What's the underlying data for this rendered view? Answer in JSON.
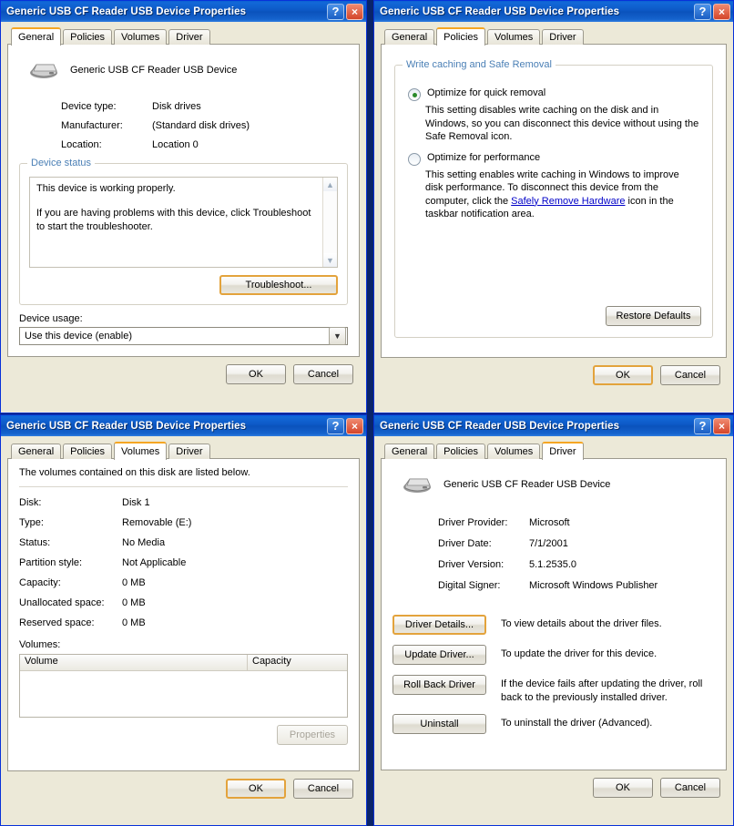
{
  "window": {
    "title": "Generic USB CF Reader USB Device Properties",
    "help_label": "?",
    "close_label": "×",
    "ok_label": "OK",
    "cancel_label": "Cancel"
  },
  "tabs": [
    {
      "label": "General"
    },
    {
      "label": "Policies"
    },
    {
      "label": "Volumes"
    },
    {
      "label": "Driver"
    }
  ],
  "general": {
    "device_name": "Generic USB CF Reader USB Device",
    "properties": [
      {
        "label": "Device type:",
        "value": "Disk drives"
      },
      {
        "label": "Manufacturer:",
        "value": "(Standard disk drives)"
      },
      {
        "label": "Location:",
        "value": "Location 0"
      }
    ],
    "status_group_label": "Device status",
    "status_line1": "This device is working properly.",
    "status_line2": "If you are having problems with this device, click Troubleshoot to start the troubleshooter.",
    "troubleshoot_label": "Troubleshoot...",
    "usage_label": "Device usage:",
    "usage_value": "Use this device (enable)"
  },
  "policies": {
    "group_label": "Write caching and Safe Removal",
    "option1_label": "Optimize for quick removal",
    "option1_desc": "This setting disables write caching on the disk and in Windows, so you can disconnect this device without using the Safe Removal icon.",
    "option1_selected": true,
    "option2_label": "Optimize for performance",
    "option2_desc_pre": "This setting enables write caching in Windows to improve disk performance. To disconnect this device from the computer, click the ",
    "option2_link": "Safely Remove Hardware",
    "option2_desc_post": " icon in the taskbar notification area.",
    "option2_selected": false,
    "restore_defaults_label": "Restore Defaults"
  },
  "volumes": {
    "intro": "The volumes contained on this disk are listed below.",
    "properties": [
      {
        "label": "Disk:",
        "value": "Disk 1"
      },
      {
        "label": "Type:",
        "value": "Removable (E:)"
      },
      {
        "label": "Status:",
        "value": "No Media"
      },
      {
        "label": "Partition style:",
        "value": "Not Applicable"
      },
      {
        "label": "Capacity:",
        "value": "0 MB"
      },
      {
        "label": "Unallocated space:",
        "value": "0 MB"
      },
      {
        "label": "Reserved space:",
        "value": "0 MB"
      }
    ],
    "volumes_label": "Volumes:",
    "columns": [
      "Volume",
      "Capacity"
    ],
    "rows": [],
    "properties_button_label": "Properties"
  },
  "driver": {
    "device_name": "Generic USB CF Reader USB Device",
    "properties": [
      {
        "label": "Driver Provider:",
        "value": "Microsoft"
      },
      {
        "label": "Driver Date:",
        "value": "7/1/2001"
      },
      {
        "label": "Driver Version:",
        "value": "5.1.2535.0"
      },
      {
        "label": "Digital Signer:",
        "value": "Microsoft Windows Publisher"
      }
    ],
    "actions": [
      {
        "button": "Driver Details...",
        "desc": "To view details about the driver files."
      },
      {
        "button": "Update Driver...",
        "desc": "To update the driver for this device."
      },
      {
        "button": "Roll Back Driver",
        "desc": "If the device fails after updating the driver, roll back to the previously installed driver."
      },
      {
        "button": "Uninstall",
        "desc": "To uninstall the driver (Advanced)."
      }
    ]
  },
  "colors": {
    "titlebar_blue": "#0a52bc",
    "focus_orange": "#e3a33c",
    "group_label_blue": "#4a7fb5",
    "link_blue": "#0000c8",
    "radio_green": "#2a8a2a",
    "close_red": "#d4452a"
  }
}
